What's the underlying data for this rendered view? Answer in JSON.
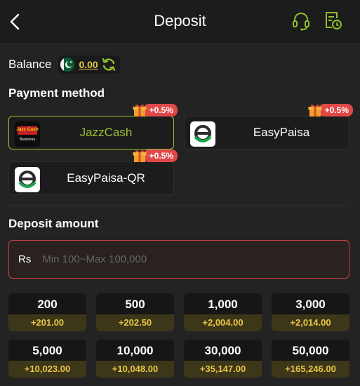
{
  "header": {
    "title": "Deposit"
  },
  "balance": {
    "label": "Balance",
    "value": "0.00"
  },
  "payment": {
    "title": "Payment method",
    "methods": [
      {
        "name": "JazzCash",
        "bonus": "+0.5%",
        "selected": true,
        "logo_text": "Jazz Cash",
        "logo_sub": "Business"
      },
      {
        "name": "EasyPaisa",
        "bonus": "+0.5%",
        "selected": false
      },
      {
        "name": "EasyPaisa-QR",
        "bonus": "+0.5%",
        "selected": false
      }
    ]
  },
  "deposit": {
    "title": "Deposit amount",
    "currency": "Rs",
    "placeholder": "Min 100~Max 100,000"
  },
  "amounts": [
    {
      "amount": "200",
      "bonus": "+201.00"
    },
    {
      "amount": "500",
      "bonus": "+202.50"
    },
    {
      "amount": "1,000",
      "bonus": "+2,004.00"
    },
    {
      "amount": "3,000",
      "bonus": "+2,014.00"
    },
    {
      "amount": "5,000",
      "bonus": "+10,023.00"
    },
    {
      "amount": "10,000",
      "bonus": "+10,048.00"
    },
    {
      "amount": "30,000",
      "bonus": "+35,147.00"
    },
    {
      "amount": "50,000",
      "bonus": "+165,246.00"
    }
  ],
  "colors": {
    "accent_green": "#9bc230",
    "error_red": "#c94040",
    "bonus_badge": "#e04848",
    "bonus_text_gold": "#e8c547"
  },
  "icons": {
    "back": "chevron-left-icon",
    "support": "headset-icon",
    "history": "document-clock-icon",
    "refresh": "refresh-icon",
    "flag": "pakistan-flag-icon",
    "gift": "gift-icon"
  }
}
